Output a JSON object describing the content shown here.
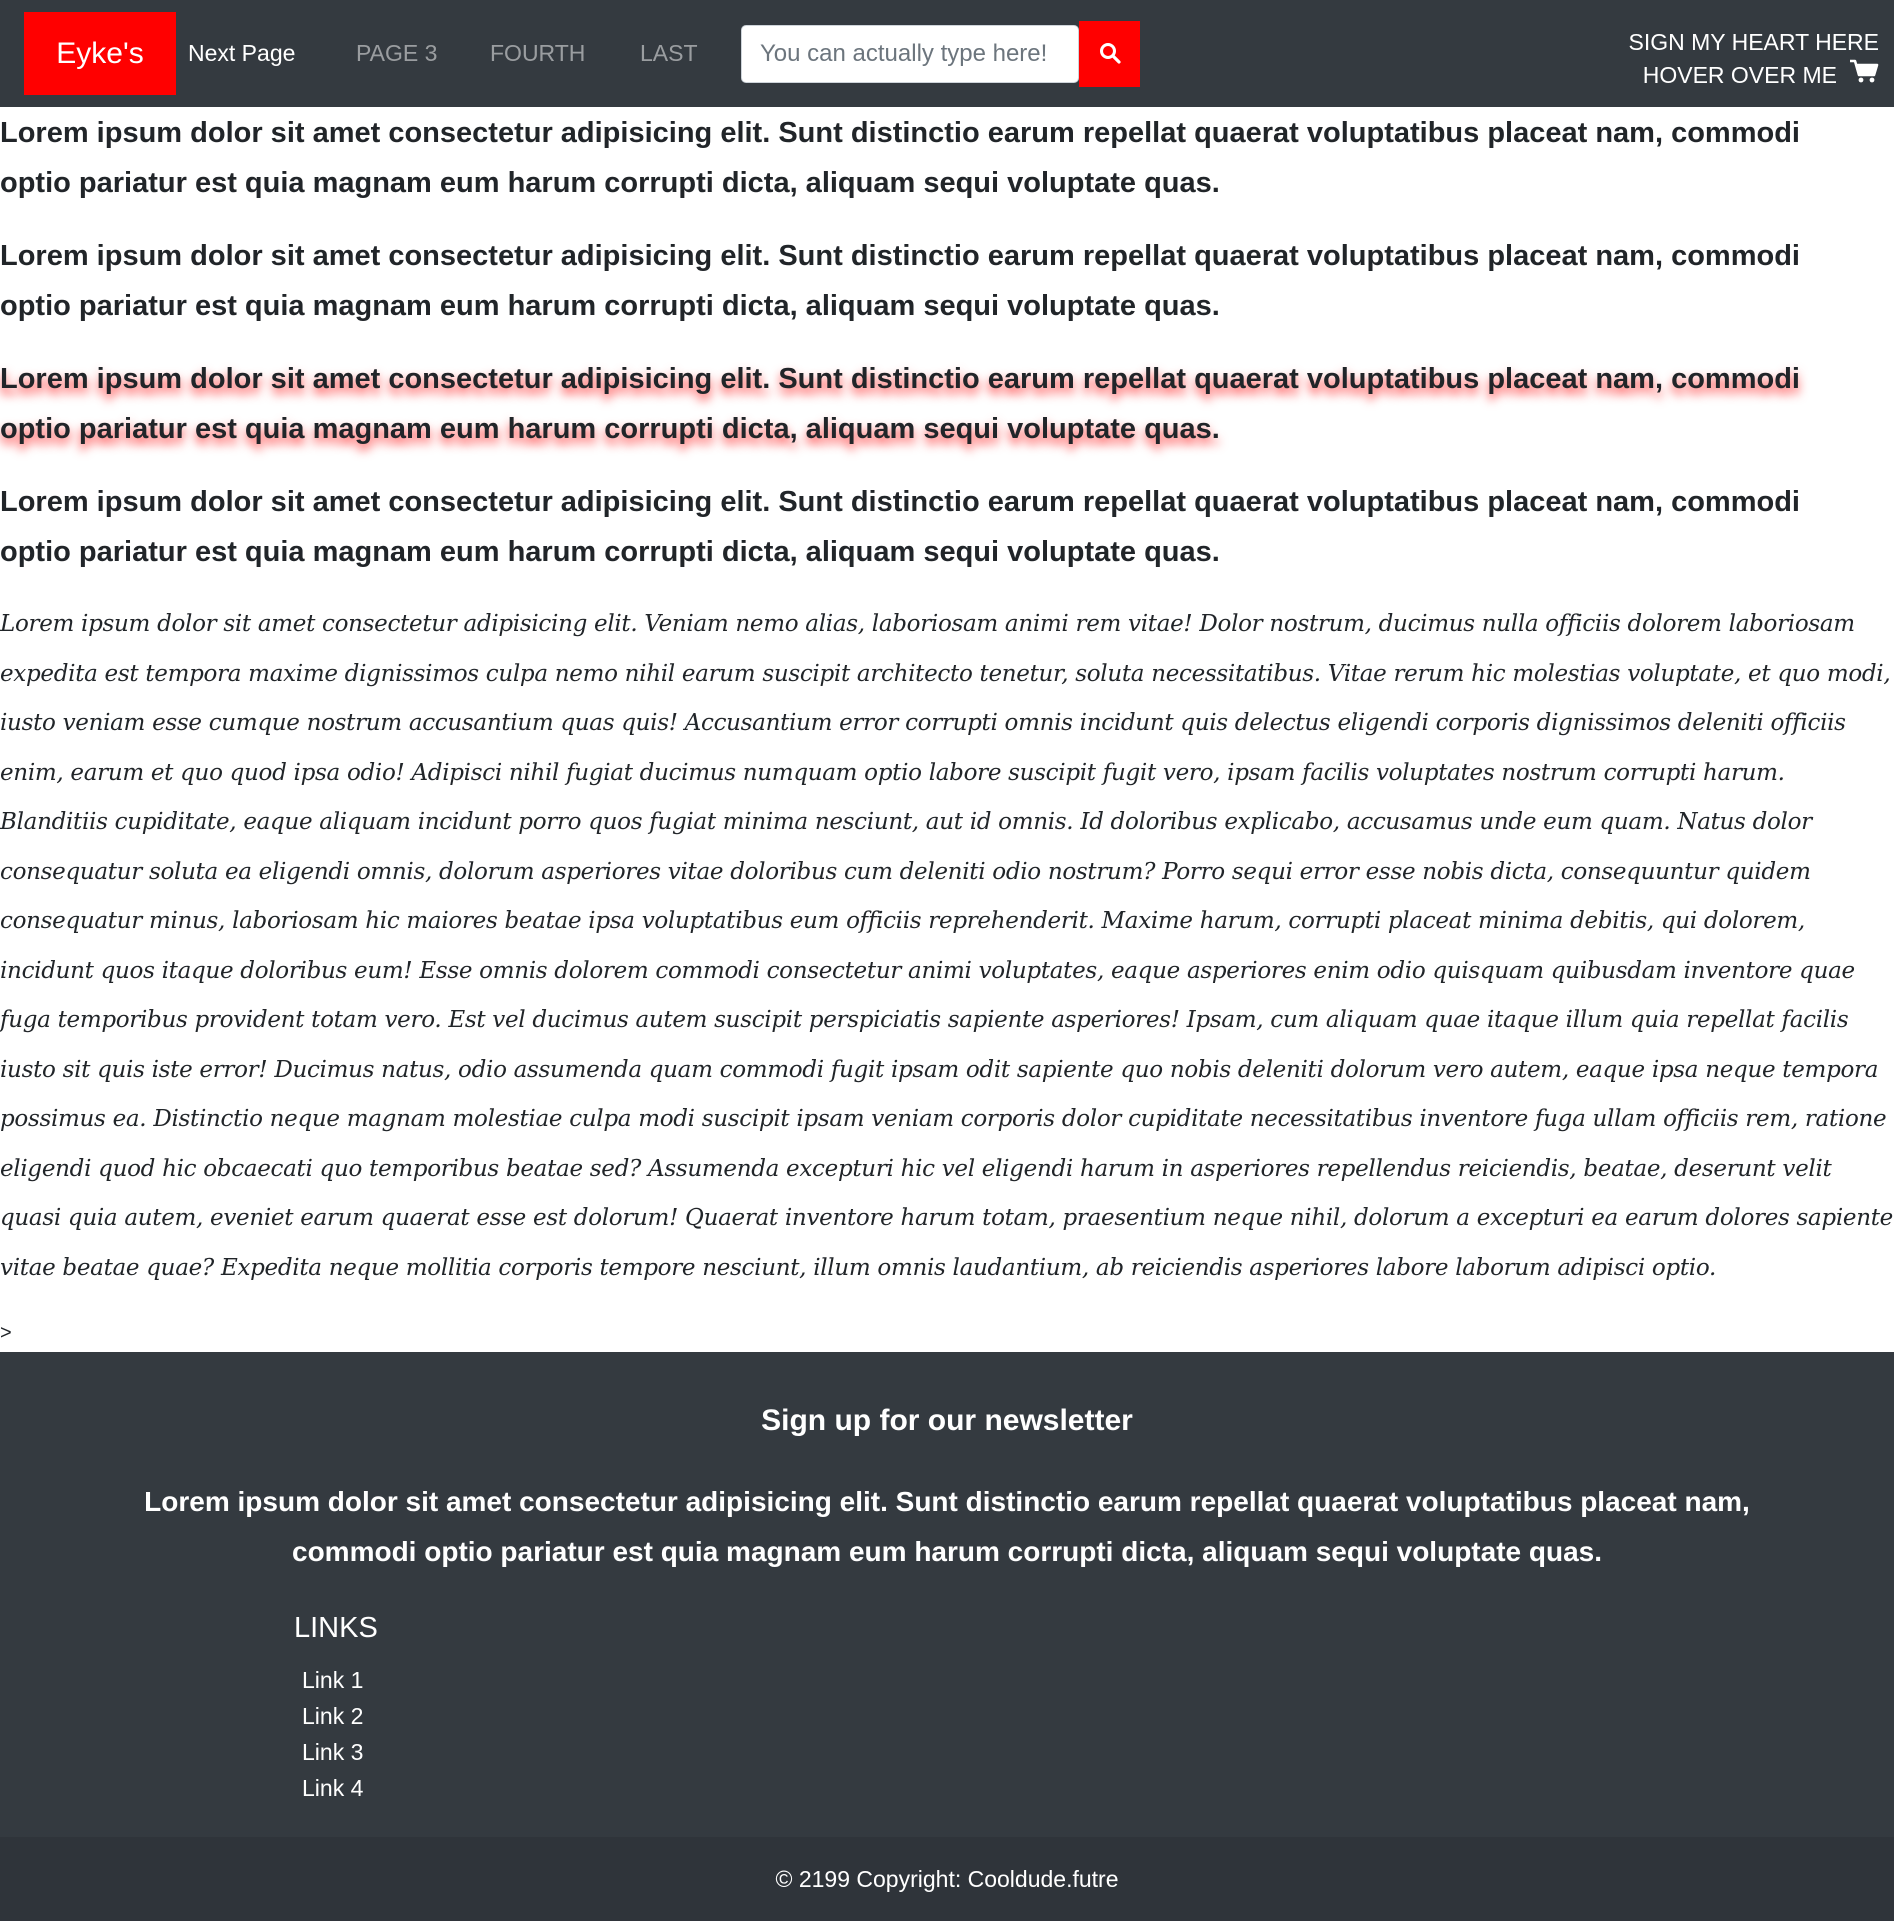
{
  "navbar": {
    "brand": "Eyke's",
    "links": [
      "Next Page",
      "PAGE 3",
      "FOURTH",
      "LAST"
    ],
    "search": {
      "placeholder": "You can actually type here!",
      "value": ""
    },
    "search_icon": "search-icon",
    "right_top": "SIGN MY HEART HERE",
    "right_bottom": "HOVER OVER ME",
    "cart_icon": "shopping-cart-icon"
  },
  "main": {
    "paragraphs": [
      "Lorem ipsum dolor sit amet consectetur adipisicing elit. Sunt distinctio earum repellat quaerat voluptatibus placeat nam, commodi optio pariatur est quia magnam eum harum corrupti dicta, aliquam sequi voluptate quas.",
      "Lorem ipsum dolor sit amet consectetur adipisicing elit. Sunt distinctio earum repellat quaerat voluptatibus placeat nam, commodi optio pariatur est quia magnam eum harum corrupti dicta, aliquam sequi voluptate quas.",
      "Lorem ipsum dolor sit amet consectetur adipisicing elit. Sunt distinctio earum repellat quaerat voluptatibus placeat nam, commodi optio pariatur est quia magnam eum harum corrupti dicta, aliquam sequi voluptate quas.",
      "Lorem ipsum dolor sit amet consectetur adipisicing elit. Sunt distinctio earum repellat quaerat voluptatibus placeat nam, commodi optio pariatur est quia magnam eum harum corrupti dicta, aliquam sequi voluptate quas."
    ],
    "long_text": "Lorem ipsum dolor sit amet consectetur adipisicing elit. Veniam nemo alias, laboriosam animi rem vitae! Dolor nostrum, ducimus nulla officiis dolorem laboriosam expedita est tempora maxime dignissimos culpa nemo nihil earum suscipit architecto tenetur, soluta necessitatibus. Vitae rerum hic molestias voluptate, et quo modi, iusto veniam esse cumque nostrum accusantium quas quis! Accusantium error corrupti omnis incidunt quis delectus eligendi corporis dignissimos deleniti officiis enim, earum et quo quod ipsa odio! Adipisci nihil fugiat ducimus numquam optio labore suscipit fugit vero, ipsam facilis voluptates nostrum corrupti harum. Blanditiis cupiditate, eaque aliquam incidunt porro quos fugiat minima nesciunt, aut id omnis. Id doloribus explicabo, accusamus unde eum quam. Natus dolor consequatur soluta ea eligendi omnis, dolorum asperiores vitae doloribus cum deleniti odio nostrum? Porro sequi error esse nobis dicta, consequuntur quidem consequatur minus, laboriosam hic maiores beatae ipsa voluptatibus eum officiis reprehenderit. Maxime harum, corrupti placeat minima debitis, qui dolorem, incidunt quos itaque doloribus eum! Esse omnis dolorem commodi consectetur animi voluptates, eaque asperiores enim odio quisquam quibusdam inventore quae fuga temporibus provident totam vero. Est vel ducimus autem suscipit perspiciatis sapiente asperiores! Ipsam, cum aliquam quae itaque illum quia repellat facilis iusto sit quis iste error! Ducimus natus, odio assumenda quam commodi fugit ipsam odit sapiente quo nobis deleniti dolorum vero autem, eaque ipsa neque tempora possimus ea. Distinctio neque magnam molestiae culpa modi suscipit ipsam veniam corporis dolor cupiditate necessitatibus inventore fuga ullam officiis rem, ratione eligendi quod hic obcaecati quo temporibus beatae sed? Assumenda excepturi hic vel eligendi harum in asperiores repellendus reiciendis, beatae, deserunt velit quasi quia autem, eveniet earum quaerat esse est dolorum! Quaerat inventore harum totam, praesentium neque nihil, dolorum a excepturi ea earum dolores sapiente vitae beatae quae? Expedita neque mollitia corporis tempore nesciunt, illum omnis laudantium, ab reiciendis asperiores labore laborum adipisci optio.",
    "stray_char": ">"
  },
  "footer": {
    "newsletter_title": "Sign up for our newsletter",
    "newsletter_text": "Lorem ipsum dolor sit amet consectetur adipisicing elit. Sunt distinctio earum repellat quaerat voluptatibus placeat nam, commodi optio pariatur est quia magnam eum harum corrupti dicta, aliquam sequi voluptate quas.",
    "links_heading": "LINKS",
    "links": [
      "Link 1",
      "Link 2",
      "Link 3",
      "Link 4"
    ],
    "copyright": "© 2199 Copyright: Cooldude.futre"
  },
  "colors": {
    "navbar_bg": "#343a40",
    "accent_red": "#ff0000",
    "footer_bottom_bg": "#2f343a"
  }
}
